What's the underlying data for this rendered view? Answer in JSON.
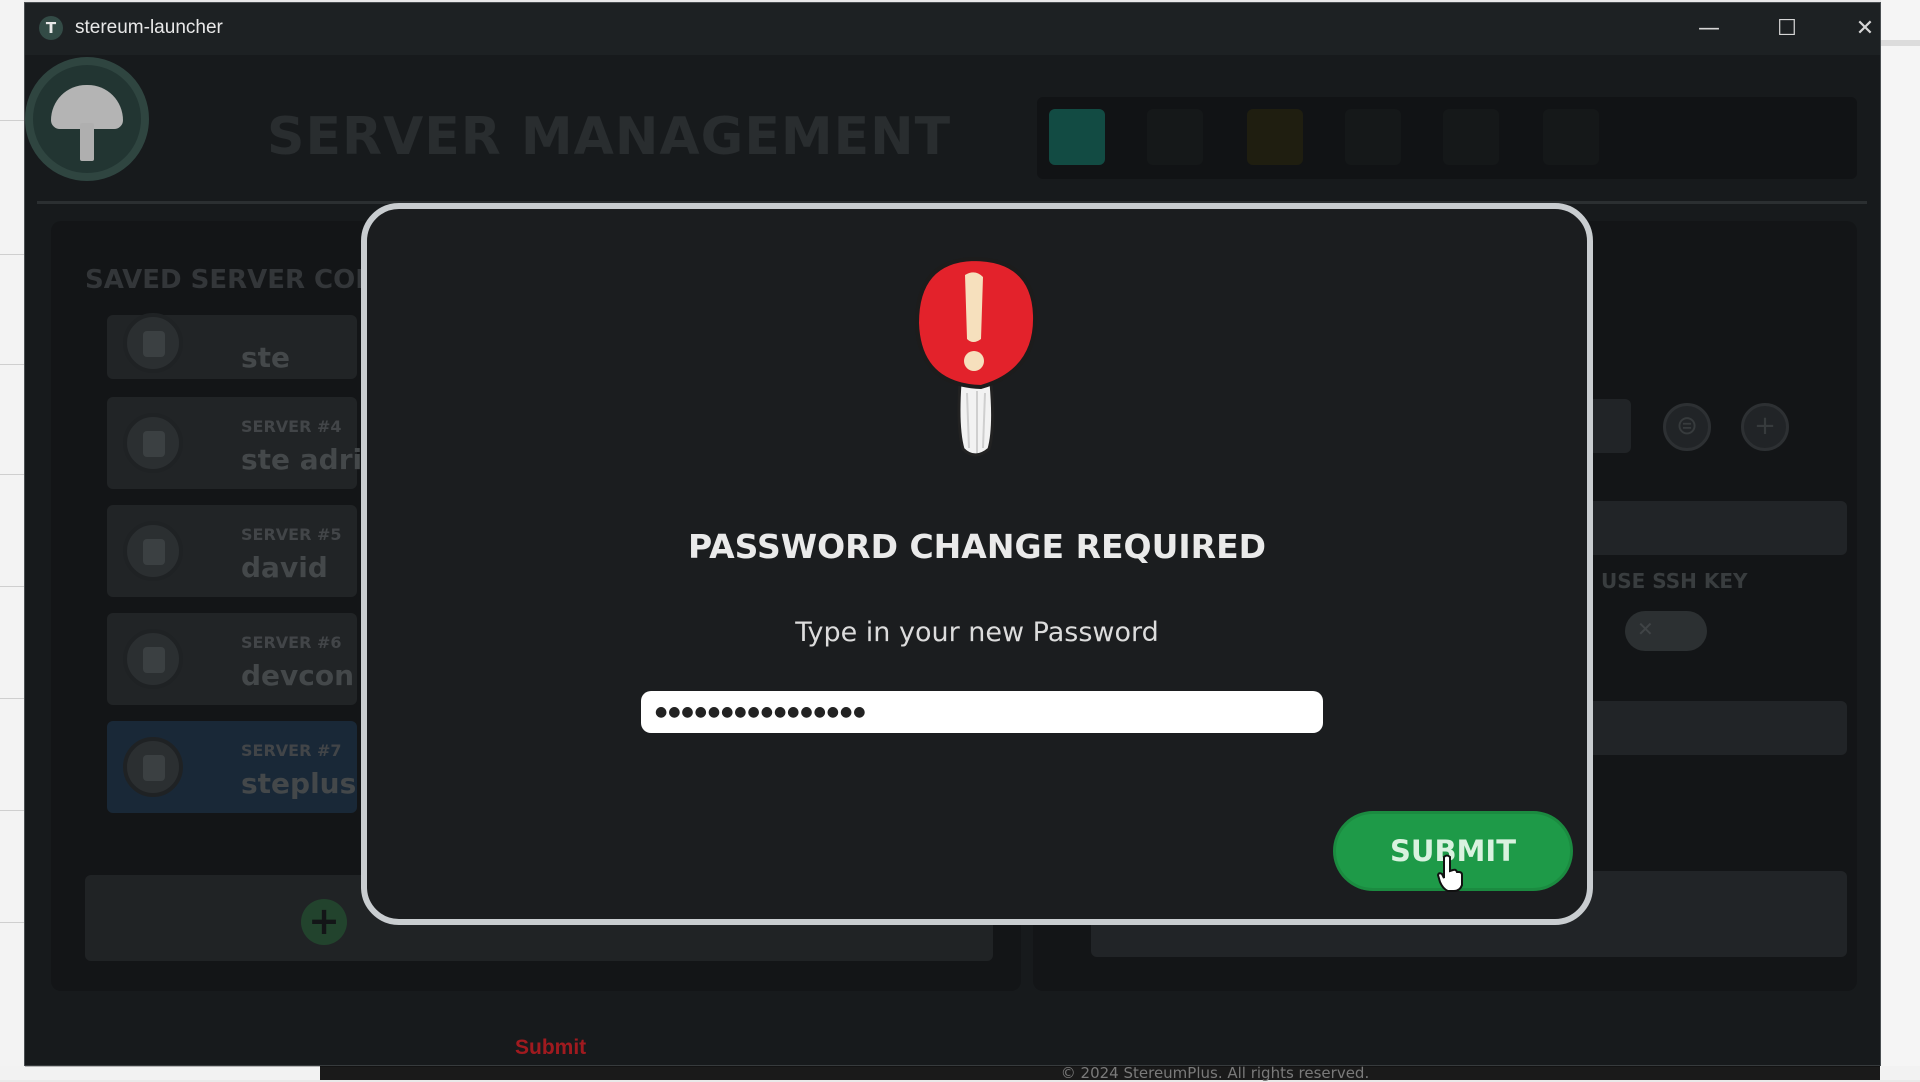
{
  "window": {
    "title": "stereum-launcher",
    "controls": {
      "minimize": "—",
      "maximize": "☐",
      "close": "✕"
    }
  },
  "header": {
    "page_title": "SERVER MANAGEMENT"
  },
  "saved_servers": {
    "title": "SAVED SERVER CON",
    "items": [
      {
        "number": "",
        "name": "ste"
      },
      {
        "number": "SERVER #4",
        "name": "ste adri"
      },
      {
        "number": "SERVER #5",
        "name": "david"
      },
      {
        "number": "SERVER #6",
        "name": "devcon"
      },
      {
        "number": "SERVER #7",
        "name": "steplus s"
      }
    ]
  },
  "right_panel": {
    "ssh_label": "USE SSH KEY"
  },
  "footer": {
    "submit_link": "Submit",
    "copyright": "© 2024 StereumPlus. All rights reserved."
  },
  "modal": {
    "title": "PASSWORD CHANGE REQUIRED",
    "subtitle": "Type in your new Password",
    "password_value": "●●●●●●●●●●●●●●●●",
    "submit_label": "SUBMIT"
  },
  "colors": {
    "submit_green": "#1e9a48",
    "warning_red": "#e3222b",
    "footer_submit_red": "#d6232a"
  }
}
